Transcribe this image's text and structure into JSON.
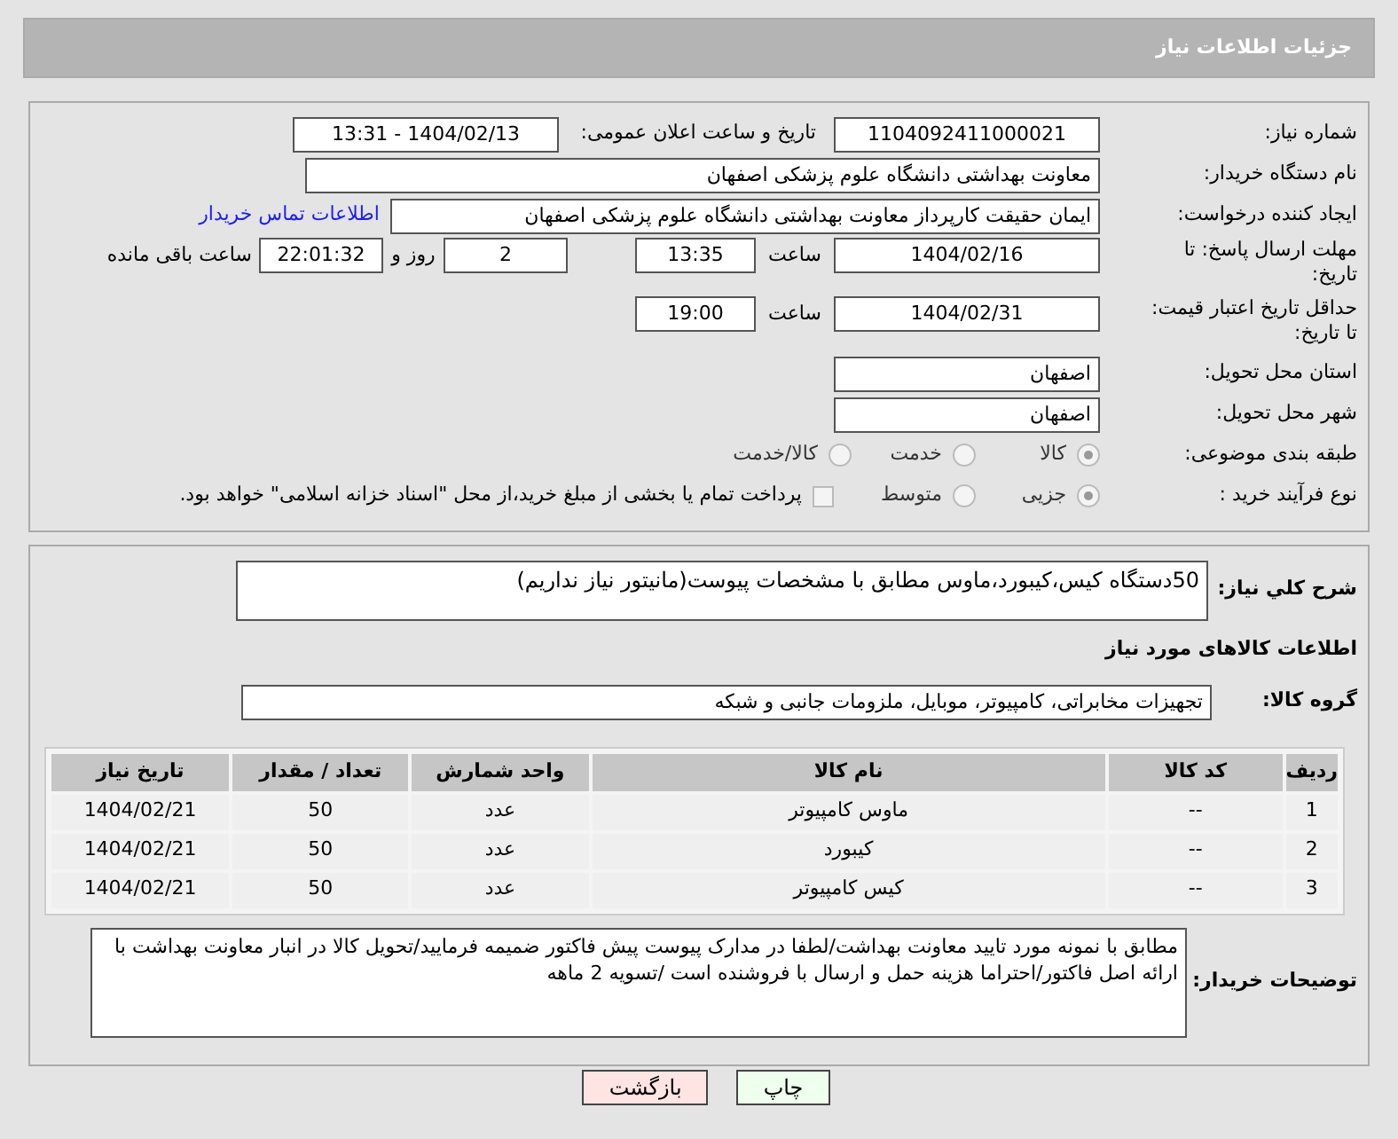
{
  "header": {
    "title": "جزئیات اطلاعات نیاز"
  },
  "form": {
    "need_number": {
      "label": "شماره نیاز:",
      "value": "1104092411000021"
    },
    "announce": {
      "label": "تاریخ و ساعت اعلان عمومی:",
      "value": "1404/02/13 - 13:31"
    },
    "buyer": {
      "label": "نام دستگاه خریدار:",
      "value": "معاونت بهداشتی دانشگاه علوم پزشکی اصفهان"
    },
    "requester": {
      "label": "ایجاد کننده درخواست:",
      "value": "ایمان حقیقت کارپرداز معاونت بهداشتی دانشگاه علوم پزشکی اصفهان",
      "link": "اطلاعات تماس خریدار"
    },
    "deadline": {
      "label": "مهلت ارسال پاسخ: تا تاریخ:",
      "date": "1404/02/16",
      "time_label": "ساعت",
      "time": "13:35",
      "days": "2",
      "days_label": "روز و",
      "remaining": "22:01:32",
      "remaining_label": "ساعت باقی مانده"
    },
    "validity": {
      "label": "حداقل تاریخ اعتبار قیمت: تا تاریخ:",
      "date": "1404/02/31",
      "time_label": "ساعت",
      "time": "19:00"
    },
    "province": {
      "label": "استان محل تحویل:",
      "value": "اصفهان"
    },
    "city": {
      "label": "شهر محل تحویل:",
      "value": "اصفهان"
    },
    "category": {
      "label": "طبقه بندی موضوعی:",
      "options": [
        {
          "label": "کالا",
          "selected": true
        },
        {
          "label": "خدمت",
          "selected": false
        },
        {
          "label": "کالا/خدمت",
          "selected": false
        }
      ]
    },
    "process": {
      "label": "نوع فرآیند خرید :",
      "options": [
        {
          "label": "جزیی",
          "selected": true
        },
        {
          "label": "متوسط",
          "selected": false
        }
      ],
      "payment": {
        "checked": false,
        "text": "پرداخت تمام یا بخشی از مبلغ خرید،از محل \"اسناد خزانه اسلامی\" خواهد بود."
      }
    }
  },
  "details": {
    "summary": {
      "label": "شرح کلي نياز:",
      "value": "50دستگاه کیس،کیبورد،ماوس مطابق با مشخصات پیوست(مانیتور نیاز نداریم)"
    },
    "goods_heading": "اطلاعات کالاهای مورد نیاز",
    "group": {
      "label": "گروه کالا:",
      "value": "تجهیزات مخابراتی، کامپیوتر، موبایل، ملزومات جانبی و شبکه"
    },
    "table": {
      "columns": [
        "ردیف",
        "کد کالا",
        "نام کالا",
        "واحد شمارش",
        "تعداد / مقدار",
        "تاریخ نیاز"
      ],
      "rows": [
        [
          "1",
          "--",
          "ماوس کامپیوتر",
          "عدد",
          "50",
          "1404/02/21"
        ],
        [
          "2",
          "--",
          "کیبورد",
          "عدد",
          "50",
          "1404/02/21"
        ],
        [
          "3",
          "--",
          "کیس کامپیوتر",
          "عدد",
          "50",
          "1404/02/21"
        ]
      ]
    },
    "comments": {
      "label": "توضیحات خریدار:",
      "value": "مطابق با نمونه مورد تایید معاونت بهداشت/لطفا در مدارک پیوست پیش فاکتور ضمیمه فرمایید/تحویل کالا در انبار معاونت بهداشت با ارائه اصل فاکتور/احتراما هزینه حمل و ارسال با فروشنده است /تسویه 2 ماهه"
    }
  },
  "buttons": [
    {
      "label": "چاپ",
      "kind": "print"
    },
    {
      "label": "بازگشت",
      "kind": "back"
    }
  ]
}
